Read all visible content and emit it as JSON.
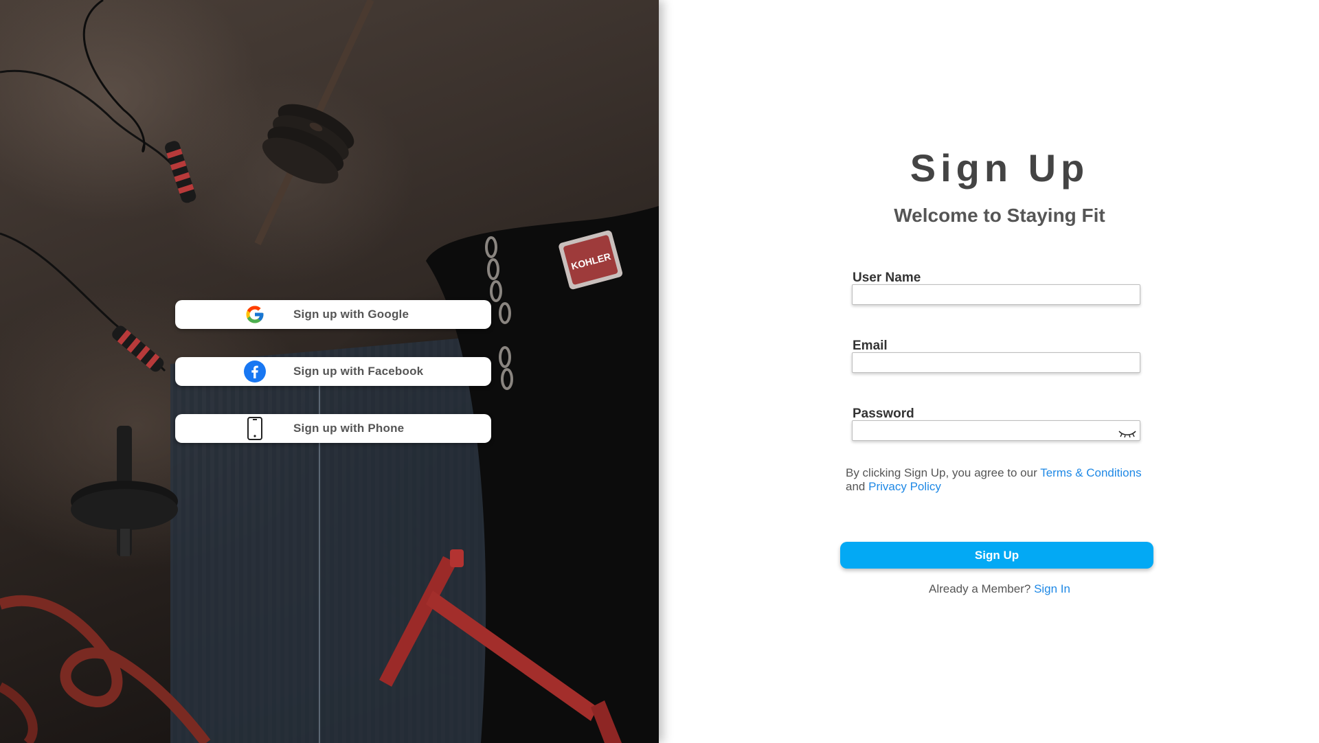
{
  "social": {
    "google_label": "Sign up with Google",
    "facebook_label": "Sign up with Facebook",
    "phone_label": "Sign up with Phone"
  },
  "form": {
    "title": "Sign Up",
    "subtitle": "Welcome to Staying Fit",
    "username_label": "User Name",
    "username_value": "",
    "email_label": "Email",
    "email_value": "",
    "password_label": "Password",
    "password_value": "",
    "terms_prefix": "By clicking Sign Up, you agree to our",
    "terms_link": "Terms & Conditions",
    "terms_and": "and",
    "privacy_link": "Privacy Policy",
    "submit_label": "Sign Up",
    "member_prefix": "Already a Member?",
    "signin_link": "Sign In"
  },
  "hero": {
    "bag_badge": "KOHLER"
  },
  "colors": {
    "accent": "#03a9f4",
    "link": "#1e88e5",
    "facebook": "#1877f2",
    "text_dark": "#444444"
  },
  "icons": [
    "google-icon",
    "facebook-icon",
    "phone-icon",
    "eye-closed-icon"
  ]
}
